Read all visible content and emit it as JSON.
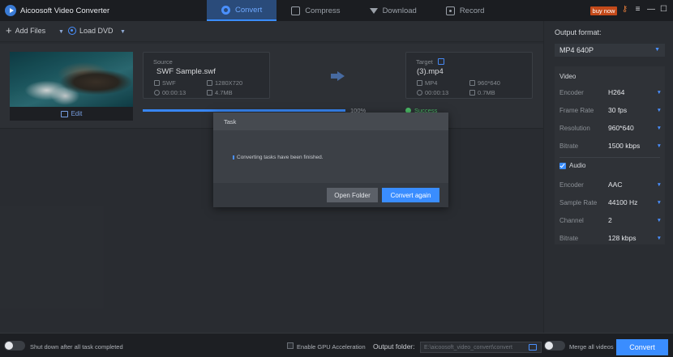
{
  "app": {
    "title": "Aicoosoft Video Converter",
    "buy_label": "buy now"
  },
  "tabs": [
    {
      "label": "Convert",
      "active": true,
      "icon": "convert-icon"
    },
    {
      "label": "Compress",
      "active": false,
      "icon": "compress-icon"
    },
    {
      "label": "Download",
      "active": false,
      "icon": "download-icon"
    },
    {
      "label": "Record",
      "active": false,
      "icon": "record-icon"
    }
  ],
  "window_controls": {
    "key": "⚷",
    "menu": "≡",
    "minimize": "—",
    "maximize": "☐",
    "close": "✕"
  },
  "toolbar": {
    "add_files": "Add Files",
    "load_dvd": "Load DVD"
  },
  "task": {
    "edit_label": "Edit",
    "source": {
      "label": "Source",
      "name": "SWF Sample.swf",
      "format": "SWF",
      "resolution": "1280X720",
      "duration": "00:00:13",
      "size": "4.7MB"
    },
    "target": {
      "label": "Target",
      "name": "(3).mp4",
      "format": "MP4",
      "resolution": "960*640",
      "duration": "00:00:13",
      "size": "0.7MB"
    },
    "progress_pct": "100%",
    "progress_value": 100,
    "status": "Success"
  },
  "sidebar": {
    "output_format_label": "Output format:",
    "output_format_value": "MP4 640P",
    "video_label": "Video",
    "video": [
      {
        "label": "Encoder",
        "value": "H264"
      },
      {
        "label": "Frame Rate",
        "value": "30 fps"
      },
      {
        "label": "Resolution",
        "value": "960*640"
      },
      {
        "label": "Bitrate",
        "value": "1500 kbps"
      }
    ],
    "audio_label": "Audio",
    "audio_checked": true,
    "audio": [
      {
        "label": "Encoder",
        "value": "AAC"
      },
      {
        "label": "Sample Rate",
        "value": "44100 Hz"
      },
      {
        "label": "Channel",
        "value": "2"
      },
      {
        "label": "Bitrate",
        "value": "128 kbps"
      }
    ]
  },
  "dialog": {
    "title": "Task",
    "message": "Converting tasks have been finished.",
    "open_folder": "Open Folder",
    "convert_again": "Convert again"
  },
  "footer": {
    "shutdown_label": "Shut down after all task completed",
    "gpu_label": "Enable GPU Acceleration",
    "output_folder_label": "Output folder:",
    "output_folder_path": "E:\\aicoosoft_video_convert\\convert",
    "merge_label": "Merge all videos",
    "convert_label": "Convert"
  },
  "colors": {
    "accent": "#3a8dff",
    "success": "#4ec36b",
    "buy_now": "#c44a1a"
  }
}
